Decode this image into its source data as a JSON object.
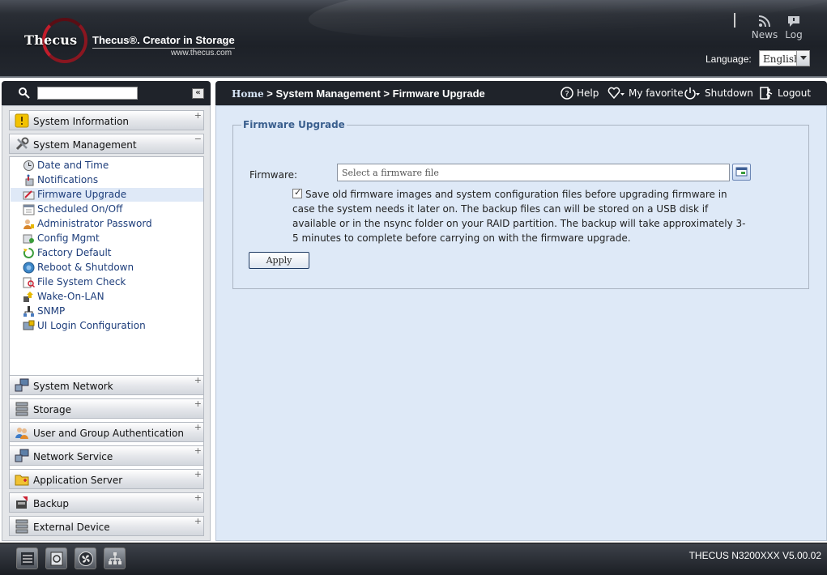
{
  "header": {
    "logo_text": "Thecus",
    "tagline": "Thecus®. Creator in Storage",
    "site": "www.thecus.com",
    "news_label": "News",
    "log_label": "Log",
    "language_label": "Language:",
    "language_value": "English"
  },
  "search": {
    "placeholder": "",
    "collapse_label": "«"
  },
  "breadcrumb": {
    "home": "Home",
    "rest": " > System Management > Firmware Upgrade"
  },
  "toolbar": {
    "help": "Help",
    "favorite": "My favorite",
    "shutdown": "Shutdown",
    "logout": "Logout"
  },
  "sidebar": {
    "categories": [
      {
        "label": "System Information",
        "icon": "info-icon",
        "state": "+"
      },
      {
        "label": "System Management",
        "icon": "tools-icon",
        "state": "−"
      },
      {
        "label": "System Network",
        "icon": "network-icon",
        "state": "+"
      },
      {
        "label": "Storage",
        "icon": "storage-icon",
        "state": "+"
      },
      {
        "label": "User and Group Authentication",
        "icon": "users-icon",
        "state": "+"
      },
      {
        "label": "Network Service",
        "icon": "network-service-icon",
        "state": "+"
      },
      {
        "label": "Application Server",
        "icon": "folder-icon",
        "state": "+"
      },
      {
        "label": "Backup",
        "icon": "backup-icon",
        "state": "+"
      },
      {
        "label": "External Device",
        "icon": "external-device-icon",
        "state": "+"
      }
    ],
    "subitems": [
      {
        "label": "Date and Time",
        "icon": "clock-icon"
      },
      {
        "label": "Notifications",
        "icon": "notification-icon"
      },
      {
        "label": "Firmware Upgrade",
        "icon": "firmware-icon",
        "selected": true
      },
      {
        "label": "Scheduled On/Off",
        "icon": "schedule-icon"
      },
      {
        "label": "Administrator Password",
        "icon": "admin-icon"
      },
      {
        "label": "Config Mgmt",
        "icon": "config-icon"
      },
      {
        "label": "Factory Default",
        "icon": "factory-icon"
      },
      {
        "label": "Reboot & Shutdown",
        "icon": "reboot-icon"
      },
      {
        "label": "File System Check",
        "icon": "filecheck-icon"
      },
      {
        "label": "Wake-On-LAN",
        "icon": "wol-icon"
      },
      {
        "label": "SNMP",
        "icon": "snmp-icon"
      },
      {
        "label": "UI Login Configuration",
        "icon": "login-config-icon"
      }
    ]
  },
  "main": {
    "section_title": "Firmware Upgrade",
    "firmware_label": "Firmware:",
    "firmware_placeholder": "Select a firmware file",
    "backup_checked": true,
    "backup_note": "Save old firmware images and system configuration files before upgrading firmware in case the system needs it later on. The backup files can will be stored on a USB disk if available or in the nsync folder on your RAID partition. The backup will take approximately 3-5 minutes to complete before carrying on with the firmware upgrade.",
    "apply_label": "Apply"
  },
  "footer": {
    "version": "THECUS N3200XXX V5.00.02"
  },
  "colors": {
    "header_bg": "#1d2128",
    "accent_red": "#c21d2b",
    "main_bg": "#dee9f7",
    "selected_bg": "#dfe9f7",
    "link_blue": "#1e3e7b"
  }
}
